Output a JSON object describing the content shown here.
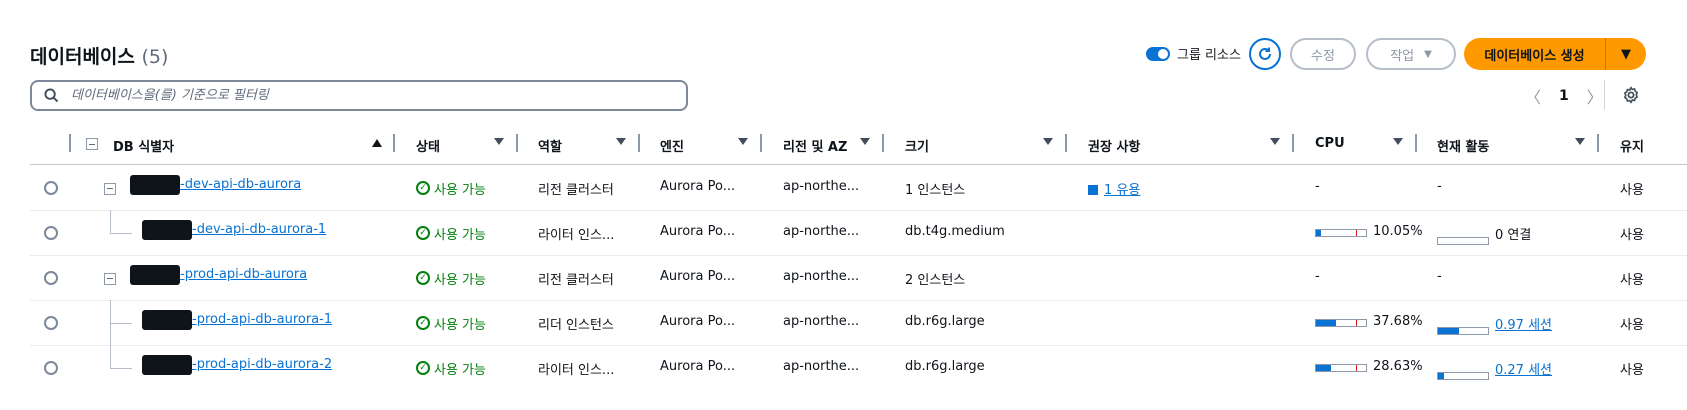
{
  "header": {
    "title": "데이터베이스",
    "count": "(5)",
    "group_toggle_label": "그룹 리소스",
    "edit_label": "수정",
    "actions_label": "작업",
    "create_label": "데이터베이스 생성"
  },
  "search": {
    "placeholder": "데이터베이스을(를) 기준으로 필터링"
  },
  "pagination": {
    "current": "1"
  },
  "columns": {
    "identifier": "DB 식별자",
    "status": "상태",
    "role": "역할",
    "engine": "엔진",
    "region": "리전 및 AZ",
    "size": "크기",
    "recommendations": "권장 사항",
    "cpu": "CPU",
    "activity": "현재 활동",
    "maintenance": "유지"
  },
  "rows": [
    {
      "name": "-dev-api-db-aurora",
      "status": "사용 가능",
      "role": "리전 클러스터",
      "engine": "Aurora Po...",
      "region": "ap-northe...",
      "size": "1 인스턴스",
      "recommendation": "1 유용",
      "cpu_text": "-",
      "activity_text": "-",
      "maint": "사용"
    },
    {
      "name": "-dev-api-db-aurora-1",
      "status": "사용 가능",
      "role": "라이터 인스...",
      "engine": "Aurora Po...",
      "region": "ap-northe...",
      "size": "db.t4g.medium",
      "recommendation": "",
      "cpu_text": "10.05%",
      "cpu": 10.05,
      "activity_text": "0 연결",
      "activity_fraction": 0,
      "maint": "사용"
    },
    {
      "name": "-prod-api-db-aurora",
      "status": "사용 가능",
      "role": "리전 클러스터",
      "engine": "Aurora Po...",
      "region": "ap-northe...",
      "size": "2 인스턴스",
      "recommendation": "",
      "cpu_text": "-",
      "activity_text": "-",
      "maint": "사용"
    },
    {
      "name": "-prod-api-db-aurora-1",
      "status": "사용 가능",
      "role": "리더 인스턴스",
      "engine": "Aurora Po...",
      "region": "ap-northe...",
      "size": "db.r6g.large",
      "recommendation": "",
      "cpu_text": "37.68%",
      "cpu": 37.68,
      "activity_text": "0.97 세션",
      "activity_fraction": 0.4,
      "maint": "사용"
    },
    {
      "name": "-prod-api-db-aurora-2",
      "status": "사용 가능",
      "role": "라이터 인스...",
      "engine": "Aurora Po...",
      "region": "ap-northe...",
      "size": "db.r6g.large",
      "recommendation": "",
      "cpu_text": "28.63%",
      "cpu": 28.63,
      "activity_text": "0.27 세션",
      "activity_fraction": 0.12,
      "maint": "사용"
    }
  ],
  "colors": {
    "accent": "#0972d3",
    "primary": "#ff9900",
    "success": "#037f0c"
  }
}
